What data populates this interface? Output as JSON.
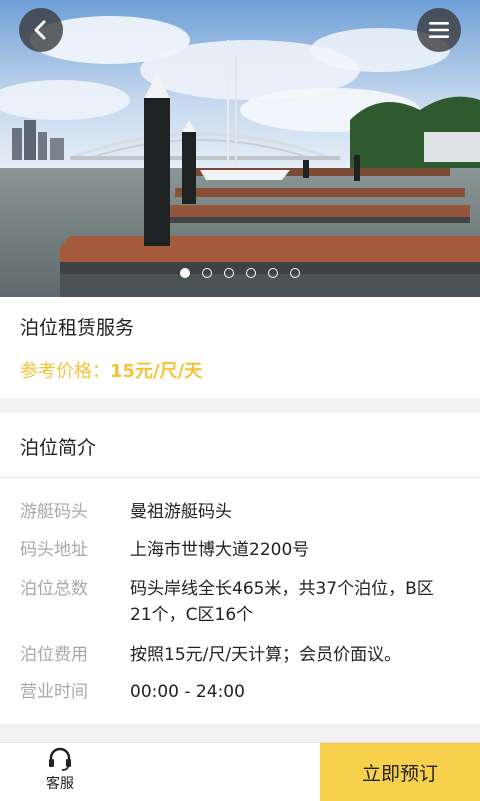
{
  "header": {
    "back_icon": "chevron-left-icon",
    "menu_icon": "menu-icon",
    "carousel": {
      "slide_count": 6,
      "active_index": 0
    }
  },
  "service": {
    "title": "泊位租赁服务",
    "price_label": "参考价格：",
    "price_value": "15元/尺/天"
  },
  "intro": {
    "title": "泊位简介",
    "rows": [
      {
        "label": "游艇码头",
        "value": "曼祖游艇码头"
      },
      {
        "label": "码头地址",
        "value": "上海市世博大道2200号"
      },
      {
        "label": "泊位总数",
        "value": "码头岸线全长465米，共37个泊位，B区21个，C区16个"
      },
      {
        "label": "泊位费用",
        "value": "按照15元/尺/天计算；会员价面议。"
      },
      {
        "label": "营业时间",
        "value": "00:00 - 24:00"
      }
    ]
  },
  "bottom": {
    "service_label": "客服",
    "service_icon": "headset-icon",
    "book_label": "立即预订"
  },
  "colors": {
    "accent": "#f7d14b",
    "price": "#f5c23a",
    "label_grey": "#a8a8a8"
  }
}
